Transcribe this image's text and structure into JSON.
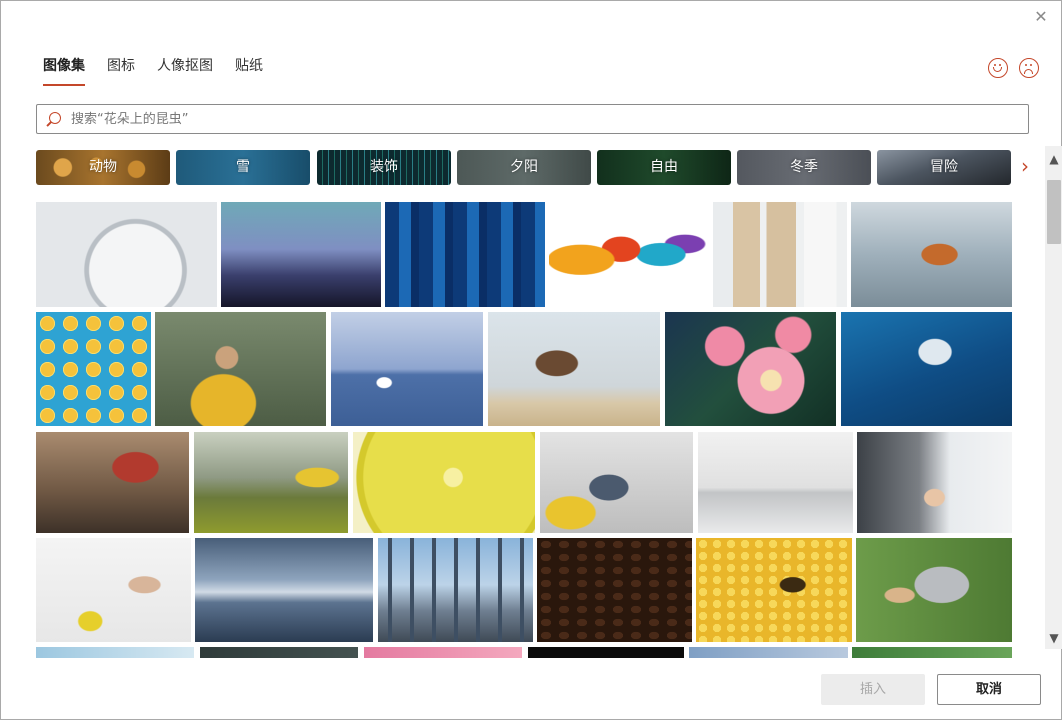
{
  "dialog": {
    "close_label": "✕"
  },
  "tabs": [
    {
      "label": "图像集",
      "active": true
    },
    {
      "label": "图标",
      "active": false
    },
    {
      "label": "人像抠图",
      "active": false
    },
    {
      "label": "贴纸",
      "active": false
    }
  ],
  "feedback": {
    "positive_icon": "smiley-face-icon",
    "negative_icon": "frown-face-icon"
  },
  "search": {
    "placeholder": "搜索“花朵上的昆虫”",
    "value": ""
  },
  "categories": [
    {
      "label": "动物"
    },
    {
      "label": "雪"
    },
    {
      "label": "装饰"
    },
    {
      "label": "夕阳"
    },
    {
      "label": "自由"
    },
    {
      "label": "冬季"
    },
    {
      "label": "冒险"
    }
  ],
  "category_next_icon": "›",
  "images": [
    {
      "name": "stopwatch"
    },
    {
      "name": "concert-crowd"
    },
    {
      "name": "skyscrapers"
    },
    {
      "name": "color-smoke"
    },
    {
      "name": "cotton-swab-jars"
    },
    {
      "name": "robotic-factory"
    },
    {
      "name": "lemon-slices-pattern"
    },
    {
      "name": "woman-in-rain"
    },
    {
      "name": "sailboat"
    },
    {
      "name": "falcon-in-flight"
    },
    {
      "name": "plumeria-flowers"
    },
    {
      "name": "microscope"
    },
    {
      "name": "woodworking-hands"
    },
    {
      "name": "hiker-mountains"
    },
    {
      "name": "lemon-closeup"
    },
    {
      "name": "team-at-whiteboard"
    },
    {
      "name": "modern-kitchen"
    },
    {
      "name": "handshake"
    },
    {
      "name": "blueprint-drawing"
    },
    {
      "name": "icebergs"
    },
    {
      "name": "shanghai-skyline"
    },
    {
      "name": "coffee-beans"
    },
    {
      "name": "bee-on-honeycomb"
    },
    {
      "name": "baseball-batter"
    },
    {
      "name": "partial-row-1"
    },
    {
      "name": "partial-row-2"
    },
    {
      "name": "partial-row-3"
    },
    {
      "name": "partial-row-4"
    },
    {
      "name": "partial-row-5"
    },
    {
      "name": "partial-row-6"
    }
  ],
  "buttons": {
    "insert_label": "插入",
    "cancel_label": "取消",
    "insert_enabled": false
  },
  "colors": {
    "accent": "#c4472a"
  }
}
